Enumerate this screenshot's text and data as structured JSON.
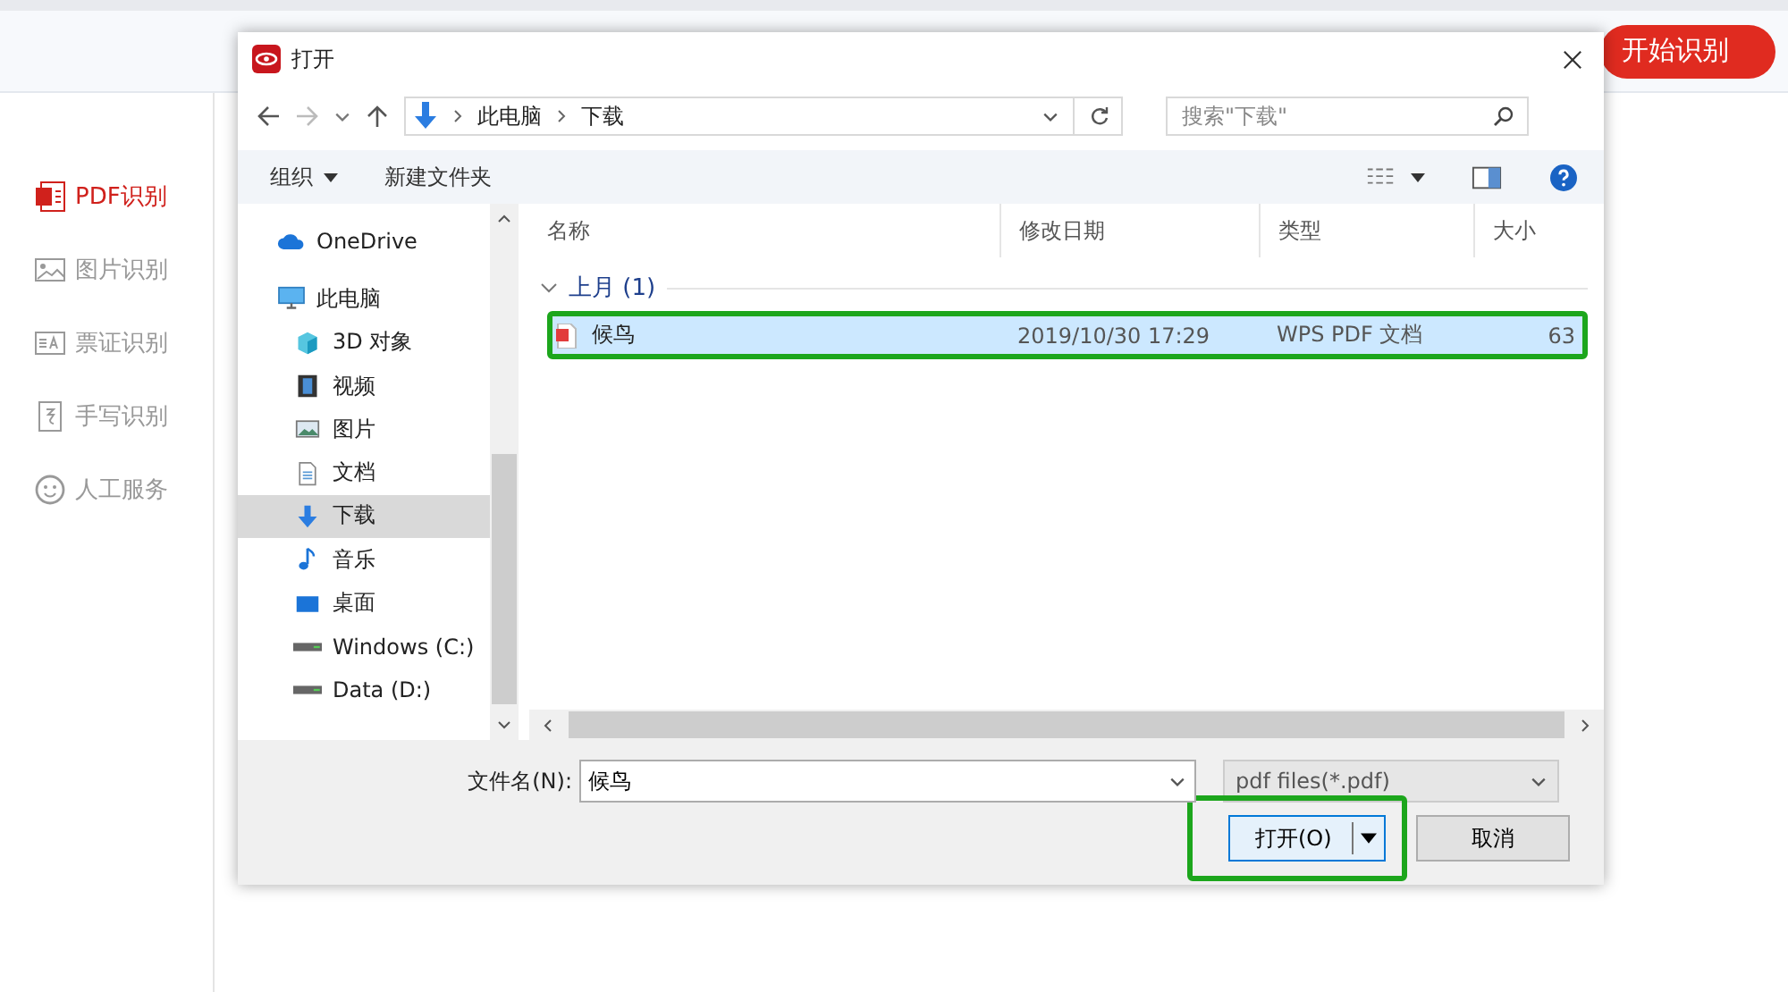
{
  "app": {
    "start_button": "开始识别",
    "sidebar": [
      {
        "label": "PDF识别",
        "kind": "pdf",
        "selected": true
      },
      {
        "label": "图片识别",
        "kind": "image",
        "selected": false
      },
      {
        "label": "票证识别",
        "kind": "ticket",
        "selected": false
      },
      {
        "label": "手写识别",
        "kind": "hand",
        "selected": false
      },
      {
        "label": "人工服务",
        "kind": "smile",
        "selected": false
      }
    ]
  },
  "dialog": {
    "title": "打开",
    "breadcrumb": [
      "此电脑",
      "下载"
    ],
    "search": {
      "placeholder": "搜索\"下载\""
    },
    "toolbar": [
      "组织",
      "新建文件夹"
    ],
    "nav": [
      {
        "label": "OneDrive",
        "kind": "cloud",
        "selected": false
      },
      {
        "label": "此电脑",
        "kind": "pc",
        "selected": false,
        "children": [
          {
            "label": "3D 对象",
            "kind": "cube",
            "selected": false
          },
          {
            "label": "视频",
            "kind": "film",
            "selected": false
          },
          {
            "label": "图片",
            "kind": "image",
            "selected": false
          },
          {
            "label": "文档",
            "kind": "doc",
            "selected": false
          },
          {
            "label": "下载",
            "kind": "download",
            "selected": true
          },
          {
            "label": "音乐",
            "kind": "music",
            "selected": false
          },
          {
            "label": "桌面",
            "kind": "desktop",
            "selected": false
          },
          {
            "label": "Windows (C:)",
            "kind": "drive",
            "selected": false
          },
          {
            "label": "Data (D:)",
            "kind": "drive",
            "selected": false
          }
        ]
      }
    ],
    "columns": [
      "名称",
      "修改日期",
      "类型",
      "大小"
    ],
    "groups": [
      {
        "label": "上月 (1)",
        "rows": [
          {
            "name": "候鸟",
            "modified": "2019/10/30 17:29",
            "type": "WPS PDF 文档",
            "size": "63",
            "selected": true,
            "highlighted": true
          }
        ]
      }
    ],
    "file_name_label": "文件名(N):",
    "file_name": "候鸟",
    "filter": "pdf files(*.pdf)",
    "open_button": {
      "label": "打开(O)",
      "highlighted": true
    },
    "cancel_button": "取消"
  }
}
